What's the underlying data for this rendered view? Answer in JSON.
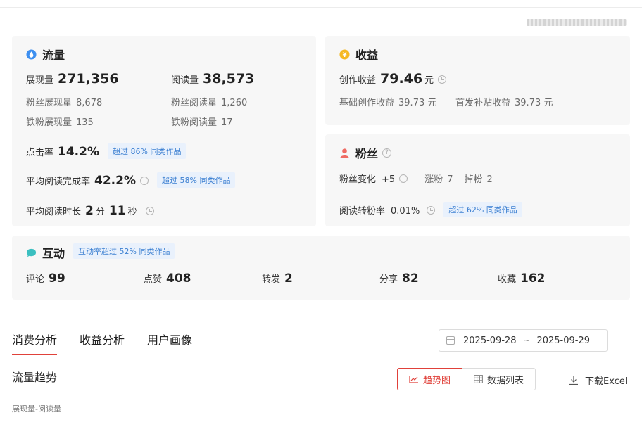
{
  "traffic": {
    "title": "流量",
    "impressions_label": "展现量",
    "impressions": "271,356",
    "reads_label": "阅读量",
    "reads": "38,573",
    "fan_impressions_label": "粉丝展现量",
    "fan_impressions": "8,678",
    "fan_reads_label": "粉丝阅读量",
    "fan_reads": "1,260",
    "iron_fan_impressions_label": "铁粉展现量",
    "iron_fan_impressions": "135",
    "iron_fan_reads_label": "铁粉阅读量",
    "iron_fan_reads": "17",
    "ctr_label": "点击率",
    "ctr": "14.2%",
    "ctr_badge": "超过 86% 同类作品",
    "completion_label": "平均阅读完成率",
    "completion": "42.2%",
    "completion_badge": "超过 58% 同类作品",
    "duration_label": "平均阅读时长",
    "duration_min": "2",
    "duration_min_unit": "分",
    "duration_sec": "11",
    "duration_sec_unit": "秒"
  },
  "earnings": {
    "title": "收益",
    "creation_label": "创作收益",
    "creation": "79.46",
    "unit": "元",
    "basic_label": "基础创作收益",
    "basic": "39.73 元",
    "subsidy_label": "首发补贴收益",
    "subsidy": "39.73 元"
  },
  "fans": {
    "title": "粉丝",
    "change_label": "粉丝变化",
    "change": "+5",
    "gain_label": "涨粉",
    "gain": "7",
    "loss_label": "掉粉",
    "loss": "2",
    "conversion_label": "阅读转粉率",
    "conversion": "0.01%",
    "conversion_badge": "超过 62% 同类作品"
  },
  "interaction": {
    "title": "互动",
    "badge": "互动率超过 52% 同类作品",
    "items": [
      {
        "label": "评论",
        "value": "99"
      },
      {
        "label": "点赞",
        "value": "408"
      },
      {
        "label": "转发",
        "value": "2"
      },
      {
        "label": "分享",
        "value": "82"
      },
      {
        "label": "收藏",
        "value": "162"
      }
    ]
  },
  "tabs": [
    "消费分析",
    "收益分析",
    "用户画像"
  ],
  "date_range": {
    "start": "2025-09-28",
    "separator": "~",
    "end": "2025-09-29"
  },
  "trend": {
    "title": "流量趋势",
    "chart_button": "趋势图",
    "table_button": "数据列表",
    "download": "下载Excel",
    "legend": "展现量-阅读量"
  },
  "colors": {
    "accent": "#e0413a",
    "badge_text": "#3b7fd1",
    "badge_bg": "#e9f1fc",
    "card_bg": "#f7f7f7"
  }
}
